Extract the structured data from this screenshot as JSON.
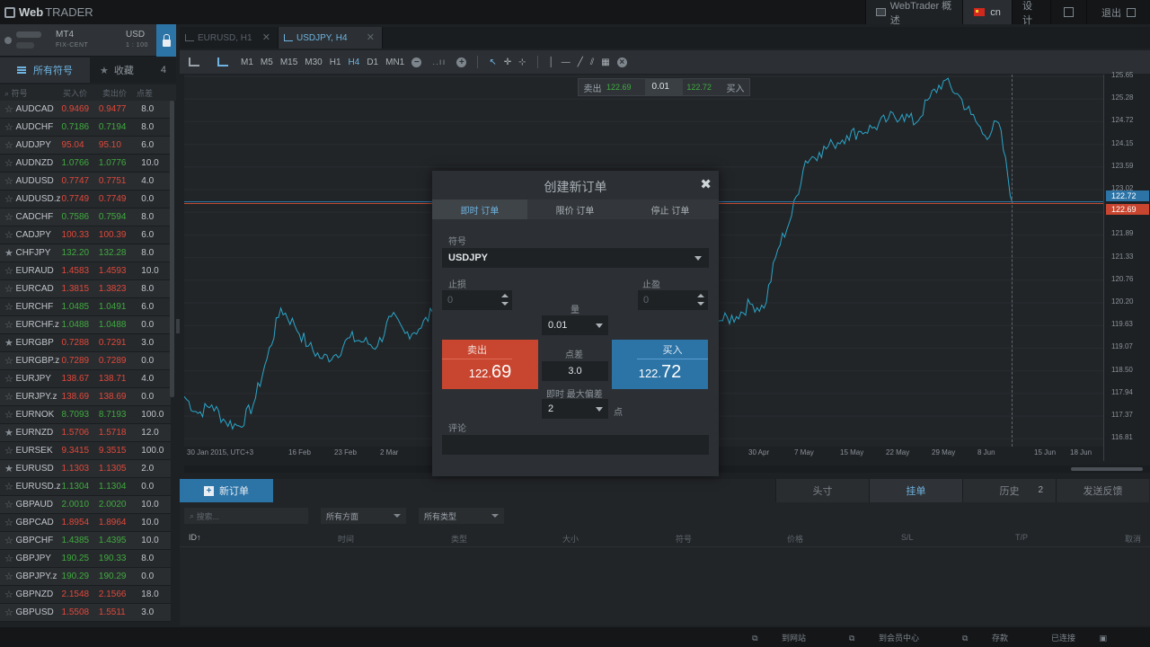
{
  "app": {
    "brand_main": "Web",
    "brand_sub": "TRADER"
  },
  "topnav": {
    "overview": "WebTrader 概述",
    "lang": "cn",
    "design": "设计",
    "logout": "退出"
  },
  "account": {
    "platform": "MT4",
    "type": "FIX-CENT",
    "currency": "USD",
    "leverage": "1 : 100"
  },
  "symbols_panel": {
    "tab_all": "所有符号",
    "tab_fav": "收藏",
    "fav_count": "4",
    "col_symbol": "符号",
    "col_bid": "买入价",
    "col_ask": "卖出价",
    "col_spread": "点差",
    "rows": [
      {
        "name": "AUDCAD",
        "bid": "0.9469",
        "ask": "0.9477",
        "spread": "8.0",
        "dir": "dn",
        "fav": false
      },
      {
        "name": "AUDCHF",
        "bid": "0.7186",
        "ask": "0.7194",
        "spread": "8.0",
        "dir": "up",
        "fav": false
      },
      {
        "name": "AUDJPY",
        "bid": "95.04",
        "ask": "95.10",
        "spread": "6.0",
        "dir": "dn",
        "fav": false
      },
      {
        "name": "AUDNZD",
        "bid": "1.0766",
        "ask": "1.0776",
        "spread": "10.0",
        "dir": "up",
        "fav": false
      },
      {
        "name": "AUDUSD",
        "bid": "0.7747",
        "ask": "0.7751",
        "spread": "4.0",
        "dir": "dn",
        "fav": false
      },
      {
        "name": "AUDUSD.z",
        "bid": "0.7749",
        "ask": "0.7749",
        "spread": "0.0",
        "dir": "dn",
        "fav": false
      },
      {
        "name": "CADCHF",
        "bid": "0.7586",
        "ask": "0.7594",
        "spread": "8.0",
        "dir": "up",
        "fav": false
      },
      {
        "name": "CADJPY",
        "bid": "100.33",
        "ask": "100.39",
        "spread": "6.0",
        "dir": "dn",
        "fav": false
      },
      {
        "name": "CHFJPY",
        "bid": "132.20",
        "ask": "132.28",
        "spread": "8.0",
        "dir": "up",
        "fav": true
      },
      {
        "name": "EURAUD",
        "bid": "1.4583",
        "ask": "1.4593",
        "spread": "10.0",
        "dir": "dn",
        "fav": false
      },
      {
        "name": "EURCAD",
        "bid": "1.3815",
        "ask": "1.3823",
        "spread": "8.0",
        "dir": "dn",
        "fav": false
      },
      {
        "name": "EURCHF",
        "bid": "1.0485",
        "ask": "1.0491",
        "spread": "6.0",
        "dir": "up",
        "fav": false
      },
      {
        "name": "EURCHF.z",
        "bid": "1.0488",
        "ask": "1.0488",
        "spread": "0.0",
        "dir": "up",
        "fav": false
      },
      {
        "name": "EURGBP",
        "bid": "0.7288",
        "ask": "0.7291",
        "spread": "3.0",
        "dir": "dn",
        "fav": true
      },
      {
        "name": "EURGBP.z",
        "bid": "0.7289",
        "ask": "0.7289",
        "spread": "0.0",
        "dir": "dn",
        "fav": false
      },
      {
        "name": "EURJPY",
        "bid": "138.67",
        "ask": "138.71",
        "spread": "4.0",
        "dir": "dn",
        "fav": false
      },
      {
        "name": "EURJPY.z",
        "bid": "138.69",
        "ask": "138.69",
        "spread": "0.0",
        "dir": "dn",
        "fav": false
      },
      {
        "name": "EURNOK",
        "bid": "8.7093",
        "ask": "8.7193",
        "spread": "100.0",
        "dir": "up",
        "fav": false
      },
      {
        "name": "EURNZD",
        "bid": "1.5706",
        "ask": "1.5718",
        "spread": "12.0",
        "dir": "dn",
        "fav": true
      },
      {
        "name": "EURSEK",
        "bid": "9.3415",
        "ask": "9.3515",
        "spread": "100.0",
        "dir": "dn",
        "fav": false
      },
      {
        "name": "EURUSD",
        "bid": "1.1303",
        "ask": "1.1305",
        "spread": "2.0",
        "dir": "dn",
        "fav": true
      },
      {
        "name": "EURUSD.z",
        "bid": "1.1304",
        "ask": "1.1304",
        "spread": "0.0",
        "dir": "up",
        "fav": false
      },
      {
        "name": "GBPAUD",
        "bid": "2.0010",
        "ask": "2.0020",
        "spread": "10.0",
        "dir": "up",
        "fav": false
      },
      {
        "name": "GBPCAD",
        "bid": "1.8954",
        "ask": "1.8964",
        "spread": "10.0",
        "dir": "dn",
        "fav": false
      },
      {
        "name": "GBPCHF",
        "bid": "1.4385",
        "ask": "1.4395",
        "spread": "10.0",
        "dir": "up",
        "fav": false
      },
      {
        "name": "GBPJPY",
        "bid": "190.25",
        "ask": "190.33",
        "spread": "8.0",
        "dir": "up",
        "fav": false
      },
      {
        "name": "GBPJPY.z",
        "bid": "190.29",
        "ask": "190.29",
        "spread": "0.0",
        "dir": "up",
        "fav": false
      },
      {
        "name": "GBPNZD",
        "bid": "2.1548",
        "ask": "2.1566",
        "spread": "18.0",
        "dir": "dn",
        "fav": false
      },
      {
        "name": "GBPUSD",
        "bid": "1.5508",
        "ask": "1.5511",
        "spread": "3.0",
        "dir": "dn",
        "fav": false
      }
    ]
  },
  "chart_tabs": [
    {
      "label": "EURUSD, H1",
      "active": false
    },
    {
      "label": "USDJPY, H4",
      "active": true
    }
  ],
  "toolbar": {
    "timeframes": [
      "M1",
      "M5",
      "M15",
      "M30",
      "H1",
      "H4",
      "D1",
      "MN1"
    ],
    "active_tf": "H4"
  },
  "quick_trade": {
    "sell": "卖出",
    "sell_price": "122.69",
    "volume": "0.01",
    "buy_price": "122.72",
    "buy": "买入"
  },
  "colors": {
    "accent": "#2c73a6",
    "sell": "#c8452f",
    "up": "#3faa3f",
    "down": "#e0483a",
    "chart_line": "#2aa6c9"
  },
  "chart_data": {
    "type": "line",
    "symbol": "USDJPY",
    "timeframe": "H4",
    "x_ticks": [
      "30 Jan 2015, UTC+3",
      "16 Feb",
      "23 Feb",
      "2 Mar",
      "30 Apr",
      "7 May",
      "15 May",
      "22 May",
      "29 May",
      "8 Jun",
      "15 Jun",
      "18 Jun"
    ],
    "y_ticks": [
      "125.65",
      "125.28",
      "124.72",
      "124.15",
      "123.59",
      "123.02",
      "122.46",
      "121.89",
      "121.33",
      "120.76",
      "120.20",
      "119.63",
      "119.07",
      "118.50",
      "117.94",
      "117.37",
      "116.81"
    ],
    "ylim": [
      116.81,
      125.65
    ],
    "current_ask": "122.72",
    "current_bid": "122.69",
    "series": [
      {
        "values": [
          118.0,
          117.6,
          117.8,
          117.4,
          117.3,
          117.8,
          118.9,
          120.1,
          119.7,
          119.2,
          118.9,
          119.0,
          119.4,
          119.3,
          119.2,
          119.9,
          119.5,
          119.6,
          120.0,
          119.8,
          120.2,
          120.5,
          121.0,
          121.1,
          120.2,
          119.9,
          119.6,
          119.7,
          119.6,
          119.2,
          118.9,
          119.3,
          119.2,
          119.0,
          119.6,
          119.4,
          119.7,
          119.5,
          119.9,
          119.8,
          119.9,
          120.2,
          120.1,
          121.5,
          122.3,
          123.6,
          123.8,
          124.0,
          124.2,
          124.3,
          124.4,
          124.6,
          124.7,
          124.5,
          125.1,
          125.5,
          125.2,
          124.7,
          124.2,
          124.5,
          122.6
        ]
      }
    ]
  },
  "bottom_panel": {
    "new_order": "新订单",
    "tab_positions": "头寸",
    "tab_pending": "挂单",
    "tab_history": "历史",
    "history_count": "2",
    "tab_feedback": "发送反馈",
    "search_placeholder": "搜索...",
    "filter_direction": "所有方面",
    "filter_type": "所有类型",
    "columns": [
      "ID↑",
      "时间",
      "类型",
      "大小",
      "符号",
      "价格",
      "S/L",
      "T/P",
      "取消"
    ]
  },
  "statusbar": {
    "website": "到网站",
    "member": "到会员中心",
    "deposit": "存款",
    "connected": "已连接"
  },
  "modal": {
    "title": "创建新订单",
    "tab_instant": "即时 订单",
    "tab_limit": "限价 订单",
    "tab_stop": "停止 订单",
    "symbol_label": "符号",
    "symbol": "USDJPY",
    "sl_label": "止损",
    "sl_value": "0",
    "tp_label": "止盈",
    "tp_value": "0",
    "volume_label": "量",
    "volume": "0.01",
    "sell_label": "卖出",
    "sell_int": "122.",
    "sell_frac": "69",
    "buy_label": "买入",
    "buy_int": "122.",
    "buy_frac": "72",
    "spread_label": "点差",
    "spread": "3.0",
    "dev_label": "即时 最大偏差",
    "dev": "2",
    "dev_unit": "点",
    "comment_label": "评论"
  }
}
